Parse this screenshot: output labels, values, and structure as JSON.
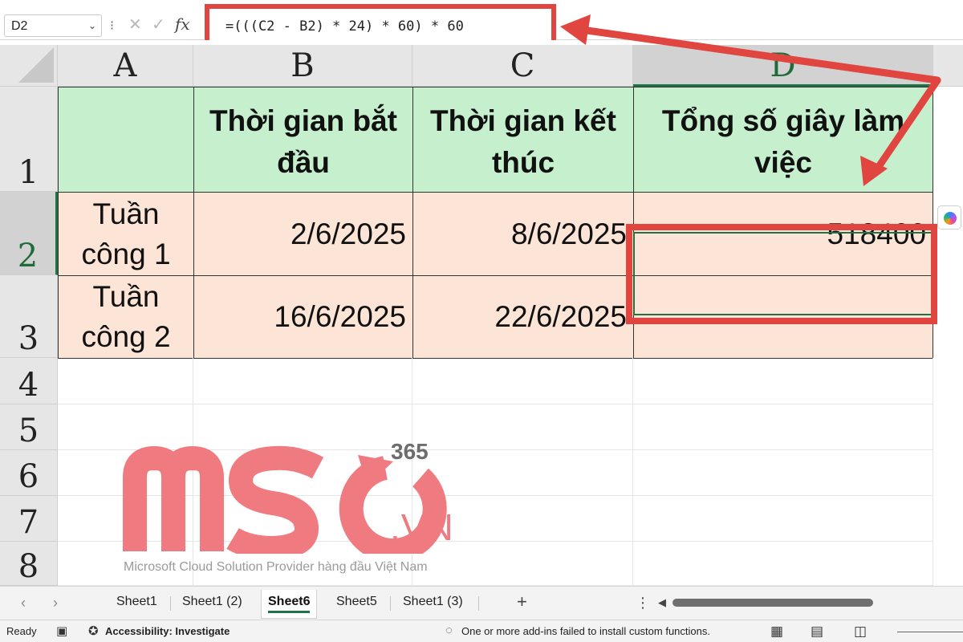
{
  "formula_bar": {
    "name_box": "D2",
    "separator": "⁝",
    "cancel_symbol": "✕",
    "enter_symbol": "✓",
    "fx_label": "fx",
    "formula": "=(((C2 - B2) * 24) * 60) * 60"
  },
  "columns": [
    "A",
    "B",
    "C",
    "D"
  ],
  "rows": [
    "1",
    "2",
    "3",
    "4",
    "5",
    "6",
    "7",
    "8"
  ],
  "table": {
    "headers": [
      "",
      "Thời gian bắt đầu",
      "Thời gian kết thúc",
      "Tổng số giây làm việc"
    ],
    "row2": {
      "a": "Tuần công 1",
      "b": "2/6/2025",
      "c": "8/6/2025",
      "d": "518400"
    },
    "row3": {
      "a": "Tuần công 2",
      "b": "16/6/2025",
      "c": "22/6/2025",
      "d": ""
    }
  },
  "watermark": {
    "brand": "MSO",
    "superscript": "365",
    "domain": ".VN",
    "tagline": "Microsoft Cloud Solution Provider hàng đầu Việt Nam"
  },
  "sheet_tabs": {
    "prev": "‹",
    "next": "›",
    "tabs": [
      "Sheet1",
      "Sheet1 (2)",
      "Sheet6",
      "Sheet5",
      "Sheet1 (3)"
    ],
    "active": "Sheet6",
    "add": "+",
    "more": "⋮"
  },
  "status_bar": {
    "ready": "Ready",
    "accessibility": "Accessibility: Investigate",
    "addins_message": "One or more add-ins failed to install custom functions."
  },
  "colors": {
    "header_fill": "#c6efce",
    "data_fill": "#fce4d6",
    "annotation_red": "#e0453f",
    "excel_green": "#1f7244",
    "watermark_pink": "#ef7a80"
  }
}
